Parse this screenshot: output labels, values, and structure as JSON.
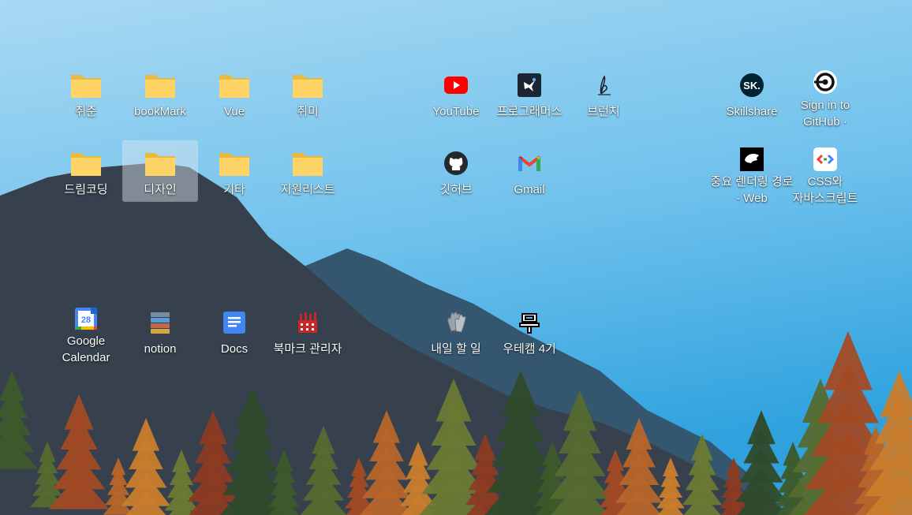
{
  "desktop": {
    "folders": [
      {
        "label": "취준",
        "icon": "folder-icon"
      },
      {
        "label": "bookMark",
        "icon": "folder-icon"
      },
      {
        "label": "Vue",
        "icon": "folder-icon"
      },
      {
        "label": "취미",
        "icon": "folder-icon"
      },
      {
        "label": "드림코딩",
        "icon": "folder-icon"
      },
      {
        "label": "디자인",
        "icon": "folder-icon",
        "selected": true
      },
      {
        "label": "기타",
        "icon": "folder-icon"
      },
      {
        "label": "지원리스트",
        "icon": "folder-icon"
      }
    ],
    "shortcuts": [
      {
        "label": "YouTube",
        "icon": "youtube-icon"
      },
      {
        "label": "프로그래머스",
        "icon": "programmers-icon"
      },
      {
        "label": "브런치",
        "icon": "brunch-icon"
      },
      {
        "label": "깃허브",
        "icon": "github-icon"
      },
      {
        "label": "Gmail",
        "icon": "gmail-icon"
      },
      {
        "label": "Skillshare",
        "icon": "skillshare-icon"
      },
      {
        "label": "Sign in to GitHub ·",
        "icon": "github-signin-icon"
      },
      {
        "label": "중요 렌더링 경로 - Web",
        "icon": "web-dev-icon"
      },
      {
        "label": "CSS와 자바스크립트",
        "icon": "css-js-icon"
      },
      {
        "label": "Google Calendar",
        "icon": "google-calendar-icon"
      },
      {
        "label": "notion",
        "icon": "notion-icon"
      },
      {
        "label": "Docs",
        "icon": "google-docs-icon"
      },
      {
        "label": "북마크 관리자",
        "icon": "bookmark-manager-icon"
      },
      {
        "label": "내일 할 일",
        "icon": "gloves-icon"
      },
      {
        "label": "우테캠 4기",
        "icon": "wootecam-icon"
      }
    ],
    "calendar_day": "28",
    "skillshare_text": "SK."
  },
  "colors": {
    "sky_top": "#a9d8f2",
    "sky_bottom": "#3aa8e0",
    "mountain_dark": "#36414d",
    "mountain_mid": "#34566f",
    "folder": "#ffd466"
  }
}
